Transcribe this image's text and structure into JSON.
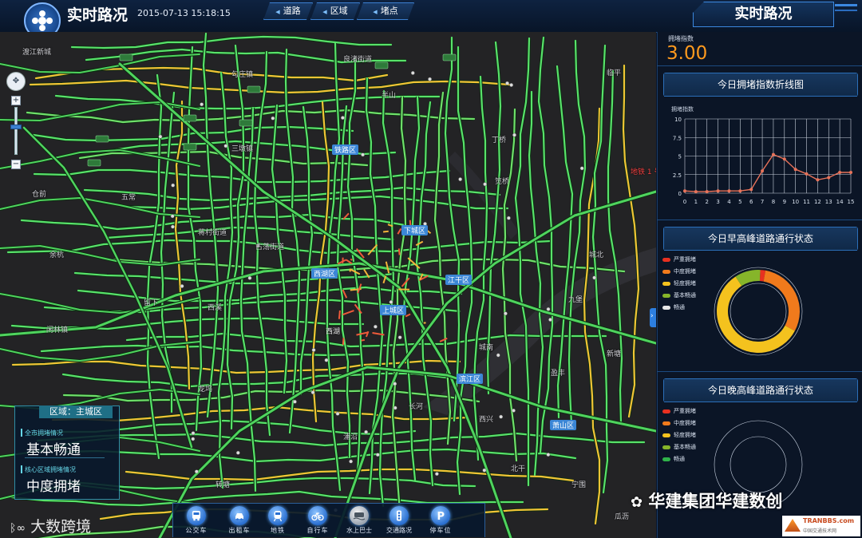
{
  "header": {
    "title": "实时路况",
    "datetime": "2015-07-13 15:18:15",
    "tabs": [
      {
        "label": "道路"
      },
      {
        "label": "区域"
      },
      {
        "label": "堵点"
      }
    ],
    "panel_title": "实时路况"
  },
  "map": {
    "zoom_control": {
      "up": "+",
      "down": "−"
    },
    "region_box": {
      "title": "区域：主城区",
      "city_label": "全市拥堵情况",
      "city_value": "基本畅通",
      "core_label": "核心区域拥堵情况",
      "core_value": "中度拥堵"
    },
    "labels": {
      "district": [
        "铁路区",
        "下城区",
        "西湖区",
        "江干区",
        "上城区",
        "滨江区",
        "萧山区"
      ],
      "places": [
        "渡江新城",
        "勾庄镇",
        "良渚街道",
        "三墩镇",
        "蒋村街道",
        "古荡街道",
        "西湖",
        "闲林镇",
        "龙坞",
        "转塘",
        "九堡",
        "临平",
        "笕桥",
        "丁桥",
        "半山",
        "仓前",
        "五常",
        "余杭",
        "留下",
        "西溪",
        "城北",
        "城南",
        "长河",
        "浦沿",
        "西兴",
        "盈丰",
        "新塘",
        "宁围",
        "北干",
        "瓜沥"
      ],
      "road_sign": "地铁 1 号线"
    },
    "toolbar": [
      {
        "label": "公交车",
        "icon": "bus-icon"
      },
      {
        "label": "出租车",
        "icon": "taxi-icon"
      },
      {
        "label": "地铁",
        "icon": "subway-icon"
      },
      {
        "label": "自行车",
        "icon": "bicycle-icon"
      },
      {
        "label": "水上巴士",
        "icon": "waterbus-icon"
      },
      {
        "label": "交通路况",
        "icon": "traffic-light-icon"
      },
      {
        "label": "停车位",
        "icon": "parking-icon"
      }
    ]
  },
  "right_panel": {
    "index_label": "拥堵指数",
    "index_value": "3.00",
    "line_card_title": "今日拥堵指数折线图",
    "morning_card_title": "今日早高峰道路通行状态",
    "evening_card_title": "今日晚高峰道路通行状态",
    "legend": [
      {
        "label": "严重拥堵",
        "color": "#e83020"
      },
      {
        "label": "中度拥堵",
        "color": "#f07a1c"
      },
      {
        "label": "轻度拥堵",
        "color": "#f4c21e"
      },
      {
        "label": "基本畅通",
        "color": "#86b52a"
      },
      {
        "label": "畅通",
        "color": "#e6e6e6"
      }
    ],
    "legend_evening": [
      {
        "label": "严重拥堵",
        "color": "#e83020"
      },
      {
        "label": "中度拥堵",
        "color": "#f07a1c"
      },
      {
        "label": "轻度拥堵",
        "color": "#f4c21e"
      },
      {
        "label": "基本畅通",
        "color": "#86b52a"
      },
      {
        "label": "畅通",
        "color": "#2fb34a"
      }
    ]
  },
  "chart_data": [
    {
      "type": "line",
      "title": "今日拥堵指数折线图",
      "ylabel": "拥堵指数",
      "xlabel": "",
      "x": [
        0,
        1,
        2,
        3,
        4,
        5,
        6,
        7,
        8,
        9,
        10,
        11,
        12,
        13,
        14,
        15
      ],
      "values": [
        0.3,
        0.2,
        0.2,
        0.3,
        0.3,
        0.3,
        0.5,
        3.0,
        5.2,
        4.6,
        3.2,
        2.6,
        1.8,
        2.1,
        2.8,
        2.8
      ],
      "ylim": [
        0,
        10
      ],
      "yticks": [
        "10",
        "7.5",
        "5",
        "2.5",
        "0"
      ],
      "xticks": [
        "0",
        "1",
        "2",
        "3",
        "4",
        "5",
        "6",
        "7",
        "8",
        "9",
        "10",
        "11",
        "12",
        "13",
        "14",
        "15"
      ],
      "grid": true,
      "color": "#e8735a"
    },
    {
      "type": "pie",
      "title": "今日早高峰道路通行状态",
      "series": [
        {
          "name": "严重拥堵",
          "value": 2
        },
        {
          "name": "中度拥堵",
          "value": 30
        },
        {
          "name": "轻度拥堵",
          "value": 58
        },
        {
          "name": "基本畅通",
          "value": 10
        },
        {
          "name": "畅通",
          "value": 0
        }
      ]
    },
    {
      "type": "pie",
      "title": "今日晚高峰道路通行状态",
      "series": []
    }
  ],
  "watermarks": {
    "right": "华建集团华建数创",
    "left": "大数跨境",
    "tran_top": "TRANBBS.com",
    "tran_bottom": "中国交通技术网"
  }
}
